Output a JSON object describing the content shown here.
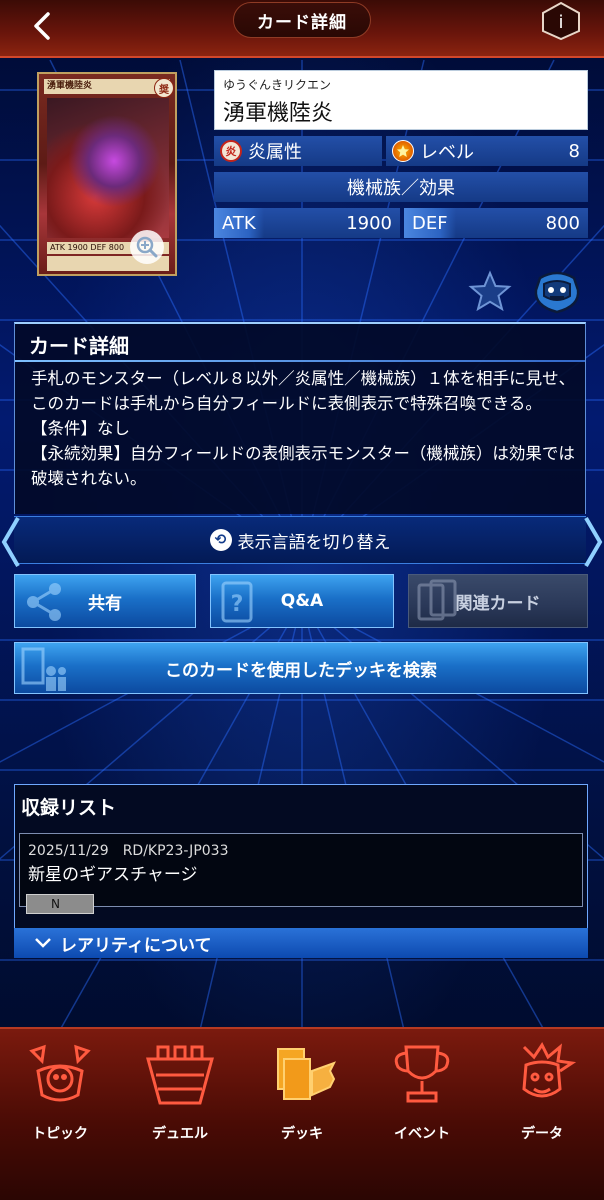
{
  "header": {
    "title": "カード詳細",
    "back_icon": "chevron-left-icon",
    "info_icon": "info-icon"
  },
  "card": {
    "reading": "ゆうぐんきリクエン",
    "name": "湧軍機陸炎",
    "attribute": "炎属性",
    "level_label": "レベル",
    "level": "8",
    "type": "機械族／効果",
    "atk_label": "ATK",
    "atk": "1900",
    "def_label": "DEF",
    "def": "800",
    "thumb_name": "湧軍機陸炎",
    "thumb_rarity": "奨",
    "thumb_stats": "ATK 1900 DEF 800"
  },
  "description": {
    "heading": "カード詳細",
    "text": "手札のモンスター（レベル８以外／炎属性／機械族）１体を相手に見せ、このカードは手札から自分フィールドに表側表示で特殊召喚できる。\n【条件】なし\n【永続効果】自分フィールドの表側表示モンスター（機械族）は効果では破壊されない。"
  },
  "language_toggle": "表示言語を切り替え",
  "buttons": {
    "share": "共有",
    "qa": "Q&A",
    "related": "関連カード",
    "deck_search": "このカードを使用したデッキを検索"
  },
  "records": {
    "heading": "収録リスト",
    "items": [
      {
        "meta": "2025/11/29　RD/KP23-JP033",
        "pack": "新星のギアスチャージ",
        "rarity": "N"
      }
    ],
    "rarity_info": "レアリティについて"
  },
  "nav": [
    {
      "label": "トピック",
      "icon": "topic-icon"
    },
    {
      "label": "デュエル",
      "icon": "duel-icon"
    },
    {
      "label": "デッキ",
      "icon": "deck-icon"
    },
    {
      "label": "イベント",
      "icon": "event-trophy-icon"
    },
    {
      "label": "データ",
      "icon": "data-icon"
    }
  ],
  "colors": {
    "header_red": "#6a150b",
    "accent_blue": "#1a70c8",
    "deck_gold": "#f5a623"
  }
}
